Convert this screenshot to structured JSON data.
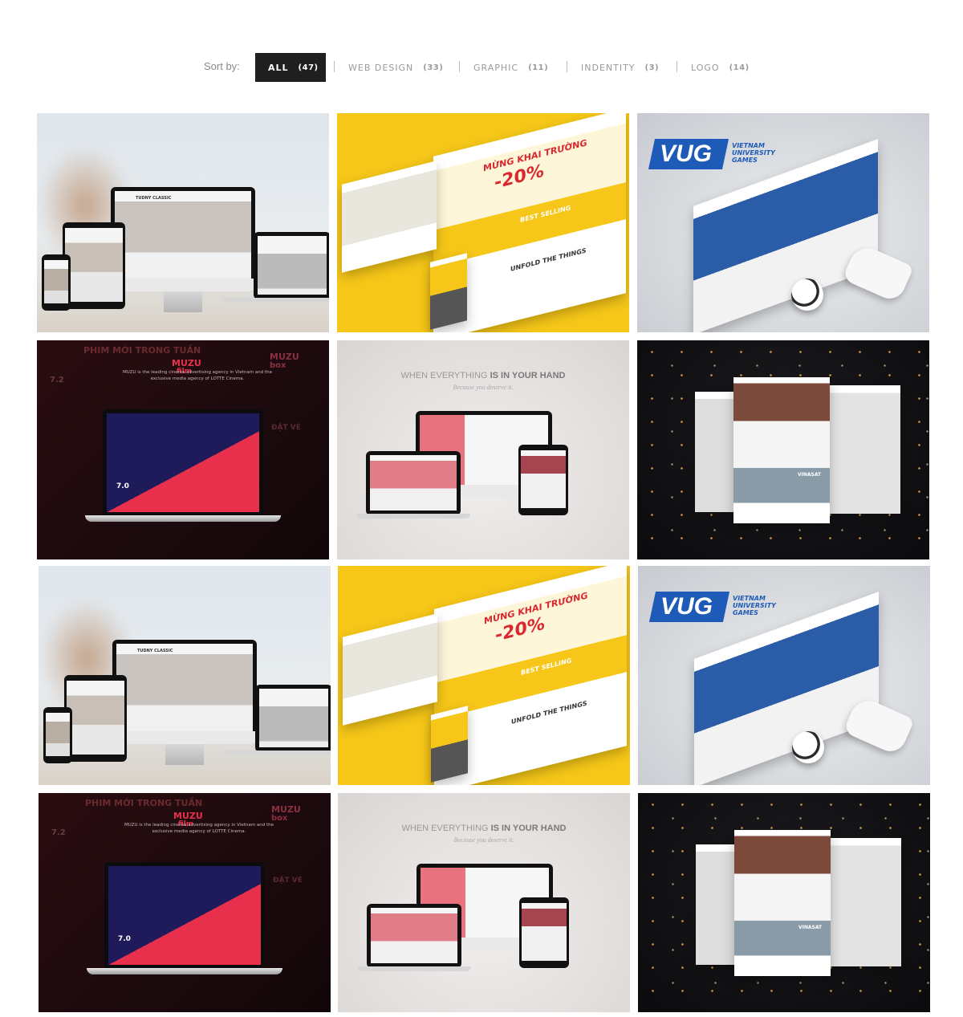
{
  "filters": {
    "sort_label": "Sort by:",
    "items": [
      {
        "name": "ALL",
        "count": "(47)",
        "active": true
      },
      {
        "name": "WEB DESIGN",
        "count": "(33)",
        "active": false
      },
      {
        "name": "GRAPHIC",
        "count": "(11)",
        "active": false
      },
      {
        "name": "INDENTITY",
        "count": "(3)",
        "active": false
      },
      {
        "name": "LOGO",
        "count": "(14)",
        "active": false
      }
    ]
  },
  "portfolio": {
    "tiles": [
      {
        "type": "beach",
        "screen_title": "TUDNY CLASSIC"
      },
      {
        "type": "yellow",
        "headline": "MỪNG KHAI TRƯỜNG",
        "discount": "-20%",
        "sub_a": "BEST SELLING",
        "sub_b": "UNFOLD THE THINGS"
      },
      {
        "type": "vug",
        "logo": "VUG",
        "logo_sub": "VIETNAM UNIVERSITY GAMES"
      },
      {
        "type": "muzu",
        "top_heading": "PHIM MỚI TRONG TUẦN",
        "brand_a": "MUZU",
        "brand_b": "film",
        "brand_c": "MUZU",
        "brand_d": "box",
        "desc": "MUZU is the leading cinema advertising agency in Vietnam and the exclusive media agency of LOTTE Cinema.",
        "rating_a": "7.2",
        "rating_b": "7.0",
        "side": "ĐẶT VÉ"
      },
      {
        "type": "hand",
        "heading_a": "WHEN EVERYTHING",
        "heading_b": "IS IN YOUR HAND",
        "sub": "Because you deserve it."
      },
      {
        "type": "night",
        "brand": "VINASAT"
      },
      {
        "type": "beach",
        "screen_title": "TUDNY CLASSIC"
      },
      {
        "type": "yellow",
        "headline": "MỪNG KHAI TRƯỜNG",
        "discount": "-20%",
        "sub_a": "BEST SELLING",
        "sub_b": "UNFOLD THE THINGS"
      },
      {
        "type": "vug",
        "logo": "VUG",
        "logo_sub": "VIETNAM UNIVERSITY GAMES"
      },
      {
        "type": "muzu",
        "top_heading": "PHIM MỚI TRONG TUẦN",
        "brand_a": "MUZU",
        "brand_b": "film",
        "brand_c": "MUZU",
        "brand_d": "box",
        "desc": "MUZU is the leading cinema advertising agency in Vietnam and the exclusive media agency of LOTTE Cinema.",
        "rating_a": "7.2",
        "rating_b": "7.0",
        "side": "ĐẶT VÉ"
      },
      {
        "type": "hand",
        "heading_a": "WHEN EVERYTHING",
        "heading_b": "IS IN YOUR HAND",
        "sub": "Because you deserve it."
      },
      {
        "type": "night",
        "brand": "VINASAT"
      }
    ]
  },
  "colors": {
    "active_filter_bg": "#1f1f1f",
    "yellow": "#f6c718",
    "vug_blue": "#1e5bb8",
    "muzu_red": "#e8304c"
  }
}
